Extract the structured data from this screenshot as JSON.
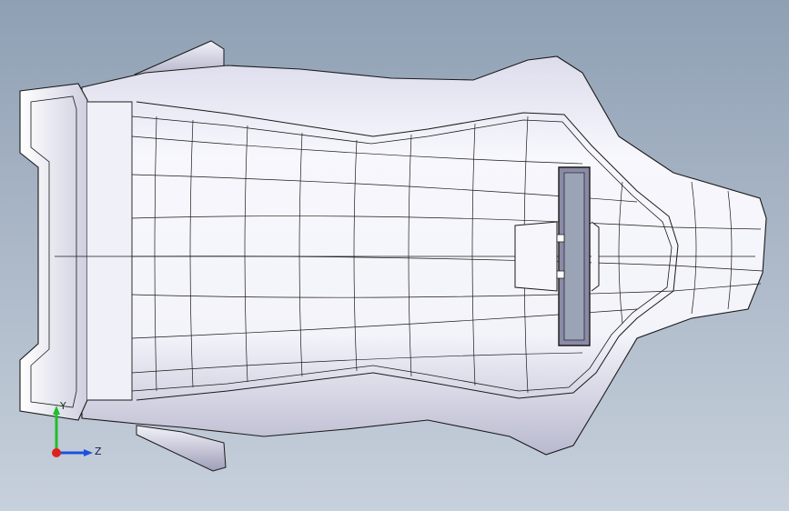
{
  "viewport": {
    "background_top": "#8fa0b4",
    "background_bottom": "#c7d0dc",
    "model_fill": "#f4f4fb",
    "model_shade": "#b6b6cc",
    "edge_color": "#1a1a1a"
  },
  "triad": {
    "y_label": "Y",
    "z_label": "Z",
    "y_color": "#1fbf2a",
    "z_color": "#1f4fe0",
    "x_color": "#e01f1f"
  }
}
